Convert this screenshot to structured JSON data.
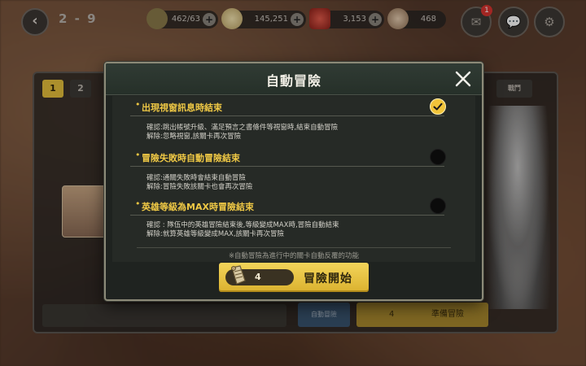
{
  "top_bar": {
    "stage": "2 - 9",
    "resources": [
      {
        "icon": "stamina-icon",
        "value": "462/63"
      },
      {
        "icon": "gold-coin-icon",
        "value": "145,251"
      },
      {
        "icon": "red-gem-icon",
        "value": "3,153"
      },
      {
        "icon": "medal-icon",
        "value": "468"
      }
    ],
    "mail_badge": "1"
  },
  "background": {
    "tabs": [
      "1",
      "2"
    ],
    "right_tab": "戰鬥",
    "blue_button": "自動冒險",
    "yellow_button_count": "4",
    "yellow_button_label": "準備冒險"
  },
  "modal": {
    "title": "自動冒險",
    "options": [
      {
        "label": "出現視窗訊息時結束",
        "enabled": true,
        "desc": [
          "確認:跳出帳號升級、滿足預言之書條件等視窗時,結束自動冒險",
          "解除:忽略視窗,該關卡再次冒險"
        ]
      },
      {
        "label": "冒險失敗時自動冒險結束",
        "enabled": false,
        "desc": [
          "確認:通關失敗時會結束自動冒險",
          "解除:冒險失敗該關卡也會再次冒險"
        ]
      },
      {
        "label": "英雄等級為MAX時冒險結束",
        "enabled": false,
        "desc": [
          "確認 : 隊伍中的英雄冒險結束後,等級變成MAX時,冒險自動結束",
          "解除:就算英雄等級變成MAX,該關卡再次冒險"
        ]
      }
    ],
    "footnote": "※自動冒險為進行中的關卡自動反覆的功能",
    "start_button": {
      "ticket_count": "4",
      "label": "冒險開始"
    }
  },
  "colors": {
    "accent_yellow": "#efc845",
    "modal_bg": "#262a26",
    "toggle_on": "#f1c43a",
    "toggle_off": "#0b0b0b"
  }
}
